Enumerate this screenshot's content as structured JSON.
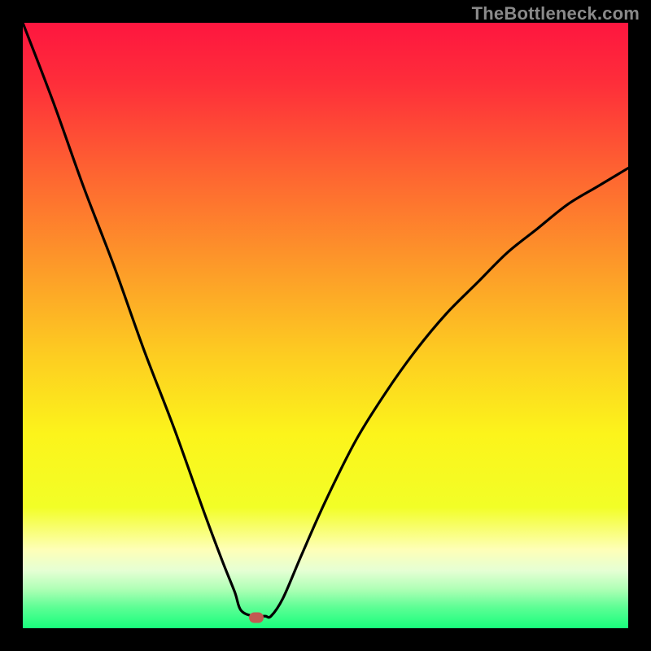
{
  "watermark": "TheBottleneck.com",
  "colors": {
    "frame_bg": "#000000",
    "marker": "#c15a52",
    "curve": "#000000",
    "gradient_stops": [
      {
        "offset": 0.0,
        "color": "#fe163f"
      },
      {
        "offset": 0.1,
        "color": "#fe2e3a"
      },
      {
        "offset": 0.25,
        "color": "#fe6531"
      },
      {
        "offset": 0.4,
        "color": "#fd9929"
      },
      {
        "offset": 0.55,
        "color": "#fdcd21"
      },
      {
        "offset": 0.68,
        "color": "#fcf41b"
      },
      {
        "offset": 0.8,
        "color": "#f2fe27"
      },
      {
        "offset": 0.87,
        "color": "#feffb7"
      },
      {
        "offset": 0.905,
        "color": "#e5ffd4"
      },
      {
        "offset": 0.935,
        "color": "#b0ffb6"
      },
      {
        "offset": 0.965,
        "color": "#5efe95"
      },
      {
        "offset": 1.0,
        "color": "#18fd7c"
      }
    ]
  },
  "marker_position": {
    "x_frac": 0.386,
    "y_frac": 0.982
  },
  "chart_data": {
    "type": "line",
    "title": "",
    "xlabel": "",
    "ylabel": "",
    "xlim": [
      0,
      1
    ],
    "ylim": [
      0,
      1
    ],
    "series": [
      {
        "name": "curve",
        "x": [
          0.0,
          0.05,
          0.1,
          0.15,
          0.2,
          0.25,
          0.3,
          0.33,
          0.35,
          0.36,
          0.38,
          0.4,
          0.41,
          0.43,
          0.46,
          0.5,
          0.55,
          0.6,
          0.65,
          0.7,
          0.75,
          0.8,
          0.85,
          0.9,
          0.95,
          1.0
        ],
        "y": [
          1.0,
          0.87,
          0.73,
          0.6,
          0.46,
          0.33,
          0.19,
          0.11,
          0.06,
          0.03,
          0.02,
          0.02,
          0.02,
          0.05,
          0.12,
          0.21,
          0.31,
          0.39,
          0.46,
          0.52,
          0.57,
          0.62,
          0.66,
          0.7,
          0.73,
          0.76
        ]
      }
    ],
    "annotations": [
      {
        "type": "marker",
        "x": 0.386,
        "y": 0.02,
        "label": "min-point"
      }
    ]
  }
}
